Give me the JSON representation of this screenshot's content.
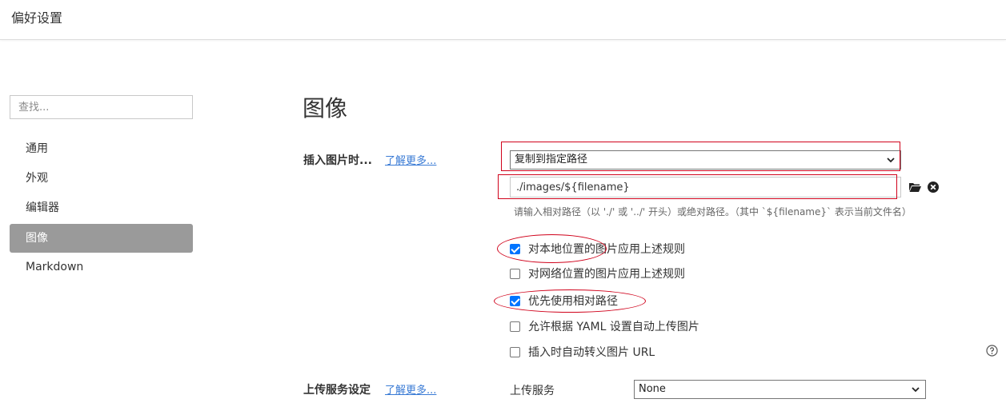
{
  "window": {
    "title": "偏好设置"
  },
  "sidebar": {
    "search_placeholder": "查找...",
    "items": [
      {
        "label": "通用",
        "active": false
      },
      {
        "label": "外观",
        "active": false
      },
      {
        "label": "编辑器",
        "active": false
      },
      {
        "label": "图像",
        "active": true
      },
      {
        "label": "Markdown",
        "active": false
      }
    ]
  },
  "main": {
    "title": "图像",
    "insert_section": {
      "label": "插入图片时...",
      "learn_more": "了解更多...",
      "action_select": "复制到指定路径",
      "path_value": "./images/${filename}",
      "hint": "请输入相对路径（以 './' 或 '../' 开头）或绝对路径。（其中 `${filename}` 表示当前文件名）",
      "options": [
        {
          "label": "对本地位置的图片应用上述规则",
          "checked": true
        },
        {
          "label": "对网络位置的图片应用上述规则",
          "checked": false
        },
        {
          "label": "优先使用相对路径",
          "checked": true
        },
        {
          "label": "允许根据 YAML 设置自动上传图片",
          "checked": false
        },
        {
          "label": "插入时自动转义图片 URL",
          "checked": false
        }
      ]
    },
    "upload_section": {
      "label": "上传服务设定",
      "learn_more": "了解更多...",
      "service_label": "上传服务",
      "service_select": "None"
    }
  },
  "icons": {
    "folder": "folder-icon",
    "clear": "clear-circle-icon",
    "help": "help-circle-icon",
    "dropdown": "chevron-down-icon"
  },
  "colors": {
    "active_nav_bg": "#9a9a9a",
    "link": "#3a7bd5",
    "annotation": "#d0021b",
    "checkbox_checked": "#0075ff"
  }
}
